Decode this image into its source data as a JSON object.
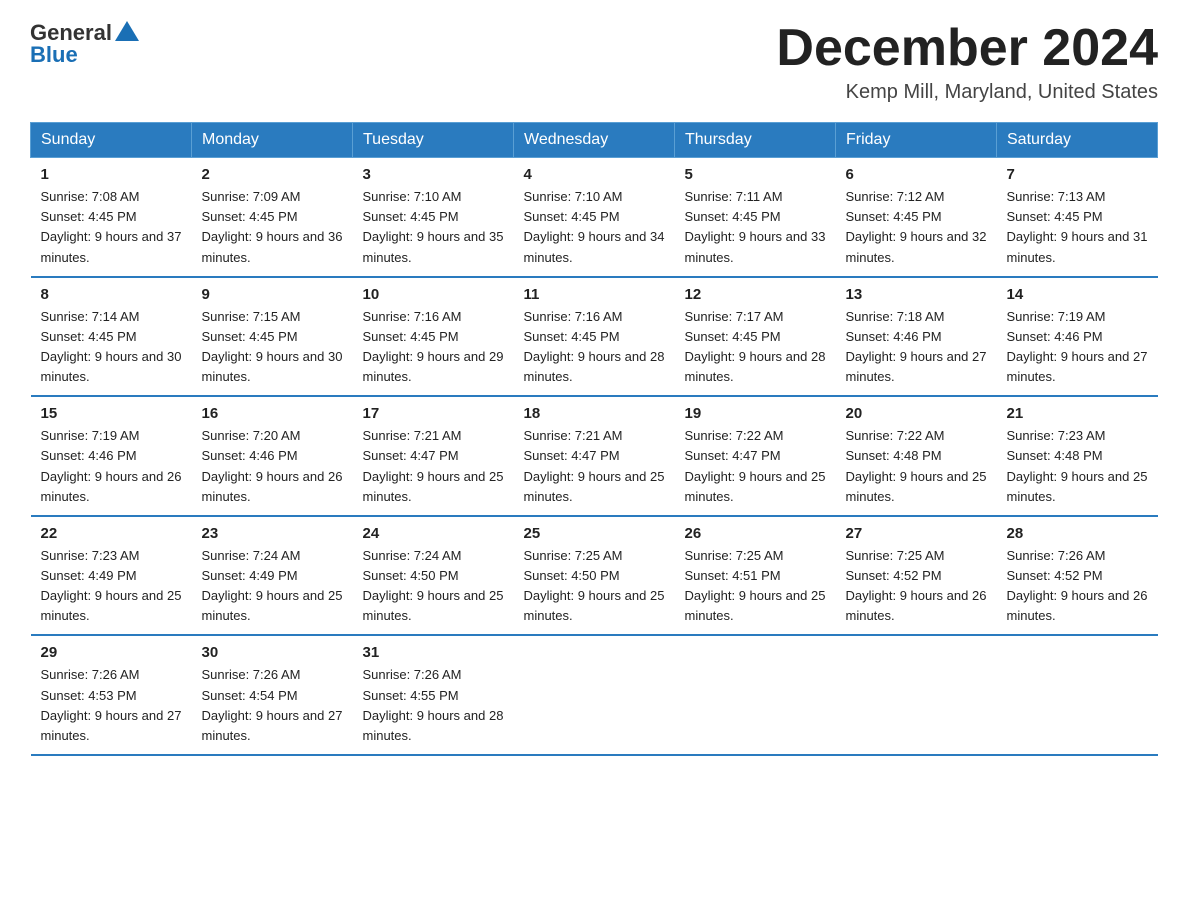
{
  "header": {
    "logo_general": "General",
    "logo_blue": "Blue",
    "month_title": "December 2024",
    "location": "Kemp Mill, Maryland, United States"
  },
  "weekdays": [
    "Sunday",
    "Monday",
    "Tuesday",
    "Wednesday",
    "Thursday",
    "Friday",
    "Saturday"
  ],
  "weeks": [
    [
      {
        "day": "1",
        "sunrise": "7:08 AM",
        "sunset": "4:45 PM",
        "daylight": "9 hours and 37 minutes."
      },
      {
        "day": "2",
        "sunrise": "7:09 AM",
        "sunset": "4:45 PM",
        "daylight": "9 hours and 36 minutes."
      },
      {
        "day": "3",
        "sunrise": "7:10 AM",
        "sunset": "4:45 PM",
        "daylight": "9 hours and 35 minutes."
      },
      {
        "day": "4",
        "sunrise": "7:10 AM",
        "sunset": "4:45 PM",
        "daylight": "9 hours and 34 minutes."
      },
      {
        "day": "5",
        "sunrise": "7:11 AM",
        "sunset": "4:45 PM",
        "daylight": "9 hours and 33 minutes."
      },
      {
        "day": "6",
        "sunrise": "7:12 AM",
        "sunset": "4:45 PM",
        "daylight": "9 hours and 32 minutes."
      },
      {
        "day": "7",
        "sunrise": "7:13 AM",
        "sunset": "4:45 PM",
        "daylight": "9 hours and 31 minutes."
      }
    ],
    [
      {
        "day": "8",
        "sunrise": "7:14 AM",
        "sunset": "4:45 PM",
        "daylight": "9 hours and 30 minutes."
      },
      {
        "day": "9",
        "sunrise": "7:15 AM",
        "sunset": "4:45 PM",
        "daylight": "9 hours and 30 minutes."
      },
      {
        "day": "10",
        "sunrise": "7:16 AM",
        "sunset": "4:45 PM",
        "daylight": "9 hours and 29 minutes."
      },
      {
        "day": "11",
        "sunrise": "7:16 AM",
        "sunset": "4:45 PM",
        "daylight": "9 hours and 28 minutes."
      },
      {
        "day": "12",
        "sunrise": "7:17 AM",
        "sunset": "4:45 PM",
        "daylight": "9 hours and 28 minutes."
      },
      {
        "day": "13",
        "sunrise": "7:18 AM",
        "sunset": "4:46 PM",
        "daylight": "9 hours and 27 minutes."
      },
      {
        "day": "14",
        "sunrise": "7:19 AM",
        "sunset": "4:46 PM",
        "daylight": "9 hours and 27 minutes."
      }
    ],
    [
      {
        "day": "15",
        "sunrise": "7:19 AM",
        "sunset": "4:46 PM",
        "daylight": "9 hours and 26 minutes."
      },
      {
        "day": "16",
        "sunrise": "7:20 AM",
        "sunset": "4:46 PM",
        "daylight": "9 hours and 26 minutes."
      },
      {
        "day": "17",
        "sunrise": "7:21 AM",
        "sunset": "4:47 PM",
        "daylight": "9 hours and 25 minutes."
      },
      {
        "day": "18",
        "sunrise": "7:21 AM",
        "sunset": "4:47 PM",
        "daylight": "9 hours and 25 minutes."
      },
      {
        "day": "19",
        "sunrise": "7:22 AM",
        "sunset": "4:47 PM",
        "daylight": "9 hours and 25 minutes."
      },
      {
        "day": "20",
        "sunrise": "7:22 AM",
        "sunset": "4:48 PM",
        "daylight": "9 hours and 25 minutes."
      },
      {
        "day": "21",
        "sunrise": "7:23 AM",
        "sunset": "4:48 PM",
        "daylight": "9 hours and 25 minutes."
      }
    ],
    [
      {
        "day": "22",
        "sunrise": "7:23 AM",
        "sunset": "4:49 PM",
        "daylight": "9 hours and 25 minutes."
      },
      {
        "day": "23",
        "sunrise": "7:24 AM",
        "sunset": "4:49 PM",
        "daylight": "9 hours and 25 minutes."
      },
      {
        "day": "24",
        "sunrise": "7:24 AM",
        "sunset": "4:50 PM",
        "daylight": "9 hours and 25 minutes."
      },
      {
        "day": "25",
        "sunrise": "7:25 AM",
        "sunset": "4:50 PM",
        "daylight": "9 hours and 25 minutes."
      },
      {
        "day": "26",
        "sunrise": "7:25 AM",
        "sunset": "4:51 PM",
        "daylight": "9 hours and 25 minutes."
      },
      {
        "day": "27",
        "sunrise": "7:25 AM",
        "sunset": "4:52 PM",
        "daylight": "9 hours and 26 minutes."
      },
      {
        "day": "28",
        "sunrise": "7:26 AM",
        "sunset": "4:52 PM",
        "daylight": "9 hours and 26 minutes."
      }
    ],
    [
      {
        "day": "29",
        "sunrise": "7:26 AM",
        "sunset": "4:53 PM",
        "daylight": "9 hours and 27 minutes."
      },
      {
        "day": "30",
        "sunrise": "7:26 AM",
        "sunset": "4:54 PM",
        "daylight": "9 hours and 27 minutes."
      },
      {
        "day": "31",
        "sunrise": "7:26 AM",
        "sunset": "4:55 PM",
        "daylight": "9 hours and 28 minutes."
      },
      null,
      null,
      null,
      null
    ]
  ]
}
